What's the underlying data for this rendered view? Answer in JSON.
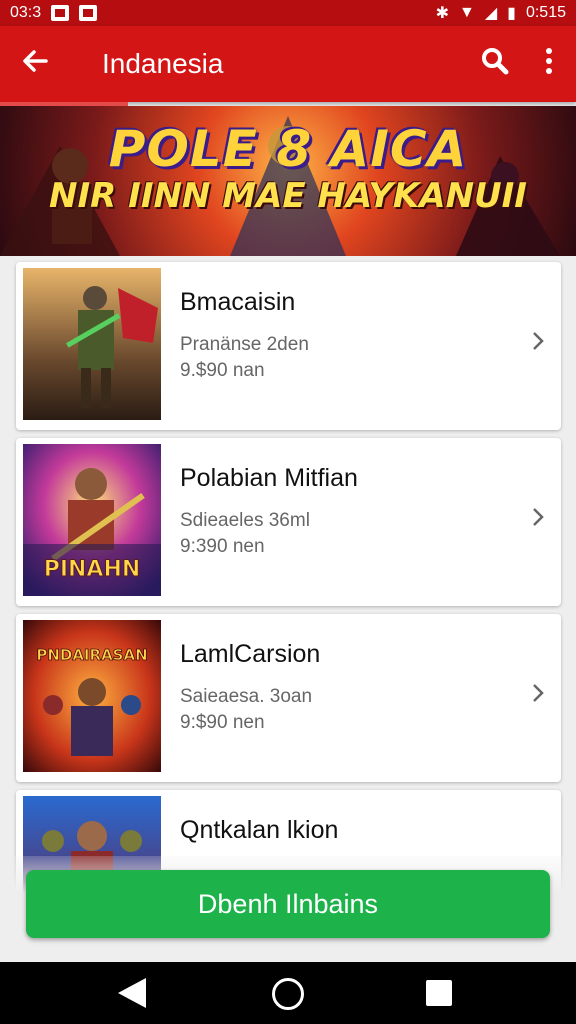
{
  "status_bar": {
    "time": "03:3",
    "battery": "0:515"
  },
  "app_bar": {
    "title": "Indanesia",
    "back_icon": "arrow-left-icon",
    "search_icon": "search-icon",
    "more_icon": "more-vert-icon"
  },
  "banner": {
    "title": "POLE 8 AICA",
    "subtitle": "NIR IINN MAE HAYKANUII"
  },
  "items": [
    {
      "name": "Bmacaisin",
      "sub": "Pranänse 2den",
      "size": "9.$90 nan"
    },
    {
      "name": "Polabian Mitfian",
      "sub": "Sdieaeles 36ml",
      "size": "9:390 nen"
    },
    {
      "name": "LamlCarsion",
      "sub": "Saieaesa. 3oan",
      "size": "9:$90 nen"
    },
    {
      "name": "Qntkalan lkion"
    }
  ],
  "thumbnails": [
    {
      "label": ""
    },
    {
      "label": "PINAHN"
    },
    {
      "label": "PNDAIRASAN"
    },
    {
      "label": ""
    }
  ],
  "cta": {
    "label": "Dbenh Ilnbains"
  },
  "colors": {
    "app_bar": "#d31515",
    "status_bar": "#b50d10",
    "cta": "#1db34a"
  }
}
